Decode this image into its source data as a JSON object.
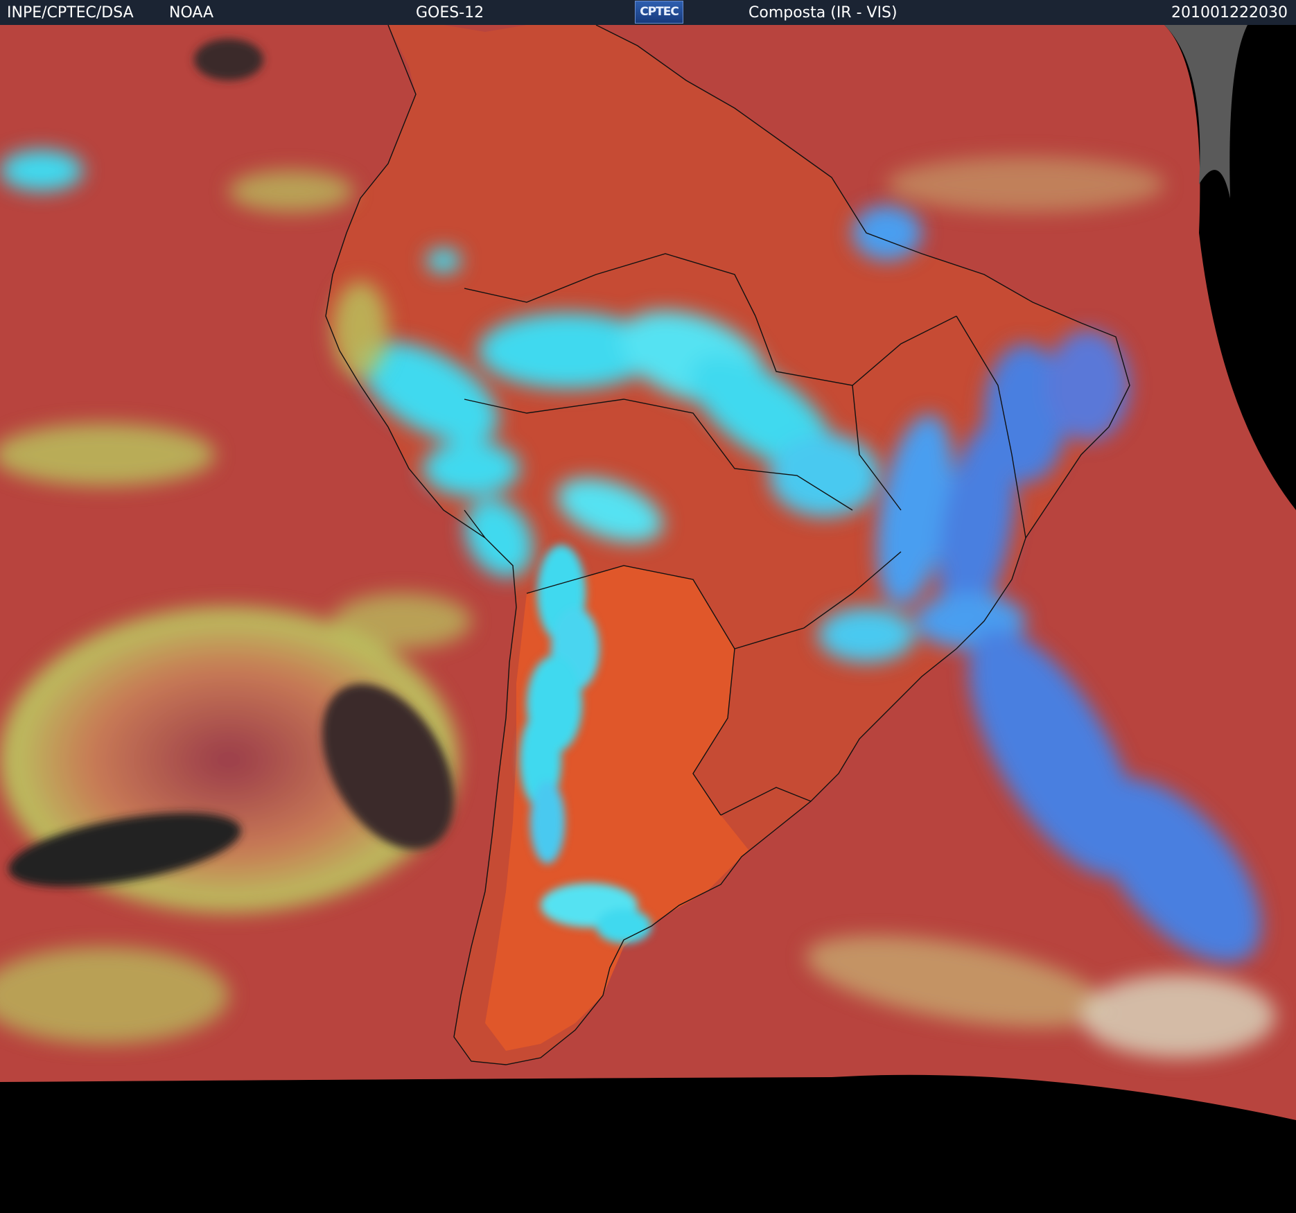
{
  "header": {
    "agency": "INPE/CPTEC/DSA",
    "source": "NOAA",
    "satellite": "GOES-12",
    "logo_text": "CPTEC",
    "product": "Composta (IR - VIS)",
    "timestamp": "201001222030"
  },
  "colors": {
    "header_bg": "#1b2433",
    "ocean_red": "#b8443e",
    "land_orange": "#d2552b",
    "cloud_cyan": "#3fd9ef",
    "cloud_blue": "#4a7fe0",
    "cloud_yellow": "#b9c75f",
    "space_black": "#000000",
    "borders": "#111111"
  },
  "map": {
    "region": "South America",
    "image_type": "satellite composite"
  }
}
